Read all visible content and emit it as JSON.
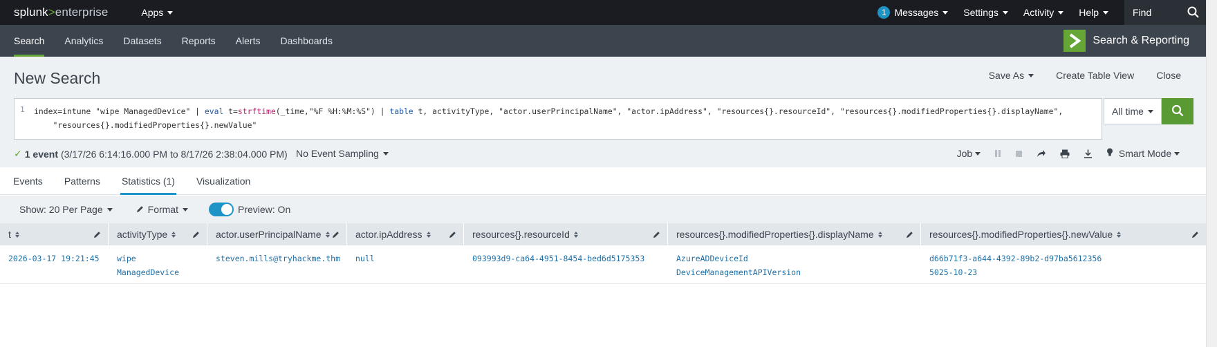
{
  "topbar": {
    "logo_splunk": "splunk",
    "logo_gt": ">",
    "logo_enterprise": "enterprise",
    "apps_label": "Apps",
    "messages_count": "1",
    "messages_label": "Messages",
    "settings_label": "Settings",
    "activity_label": "Activity",
    "help_label": "Help",
    "find_placeholder": "Find"
  },
  "appbar": {
    "tabs": [
      {
        "label": "Search"
      },
      {
        "label": "Analytics"
      },
      {
        "label": "Datasets"
      },
      {
        "label": "Reports"
      },
      {
        "label": "Alerts"
      },
      {
        "label": "Dashboards"
      }
    ],
    "active_tab": "Search",
    "app_title": "Search & Reporting"
  },
  "page": {
    "title": "New Search",
    "save_as": "Save As",
    "create_table_view": "Create Table View",
    "close": "Close"
  },
  "search": {
    "line_number": "1",
    "query_parts": {
      "p1": "index=intune \"wipe ManagedDevice\" | ",
      "kw1": "eval",
      "p2": " t=",
      "fn1": "strftime",
      "p3": "(_time,\"%F %H:%M:%S\") | ",
      "kw2": "table",
      "p4": " t, activityType, \"actor.userPrincipalName\", \"actor.ipAddress\", \"resources{}.resourceId\", \"resources{}.modifiedProperties{}.displayName\",\n    \"resources{}.modifiedProperties{}.newValue\""
    },
    "time_range": "All time"
  },
  "status": {
    "event_count": "1 event",
    "range": "(3/17/26 6:14:16.000 PM to 8/17/26 2:38:04.000 PM)",
    "sampling": "No Event Sampling",
    "job_label": "Job",
    "mode_label": "Smart Mode"
  },
  "results_tabs": [
    {
      "label": "Events"
    },
    {
      "label": "Patterns"
    },
    {
      "label": "Statistics (1)"
    },
    {
      "label": "Visualization"
    }
  ],
  "active_results_tab": "Statistics (1)",
  "toolbar": {
    "show_label": "Show: 20 Per Page",
    "format_label": "Format",
    "preview_label": "Preview: On"
  },
  "table": {
    "columns": [
      "t",
      "activityType",
      "actor.userPrincipalName",
      "actor.ipAddress",
      "resources{}.resourceId",
      "resources{}.modifiedProperties{}.displayName",
      "resources{}.modifiedProperties{}.newValue"
    ],
    "rows": [
      {
        "t": "2026-03-17 19:21:45",
        "activityType": "wipe ManagedDevice",
        "upn": "steven.mills@tryhackme.thm",
        "ip": "null",
        "resourceId": "093993d9-ca64-4951-8454-bed6d5175353",
        "displayName": [
          "AzureADDeviceId",
          "DeviceManagementAPIVersion"
        ],
        "newValue": [
          "d66b71f3-a644-4392-89b2-d97ba5612356",
          "5025-10-23"
        ]
      }
    ]
  }
}
